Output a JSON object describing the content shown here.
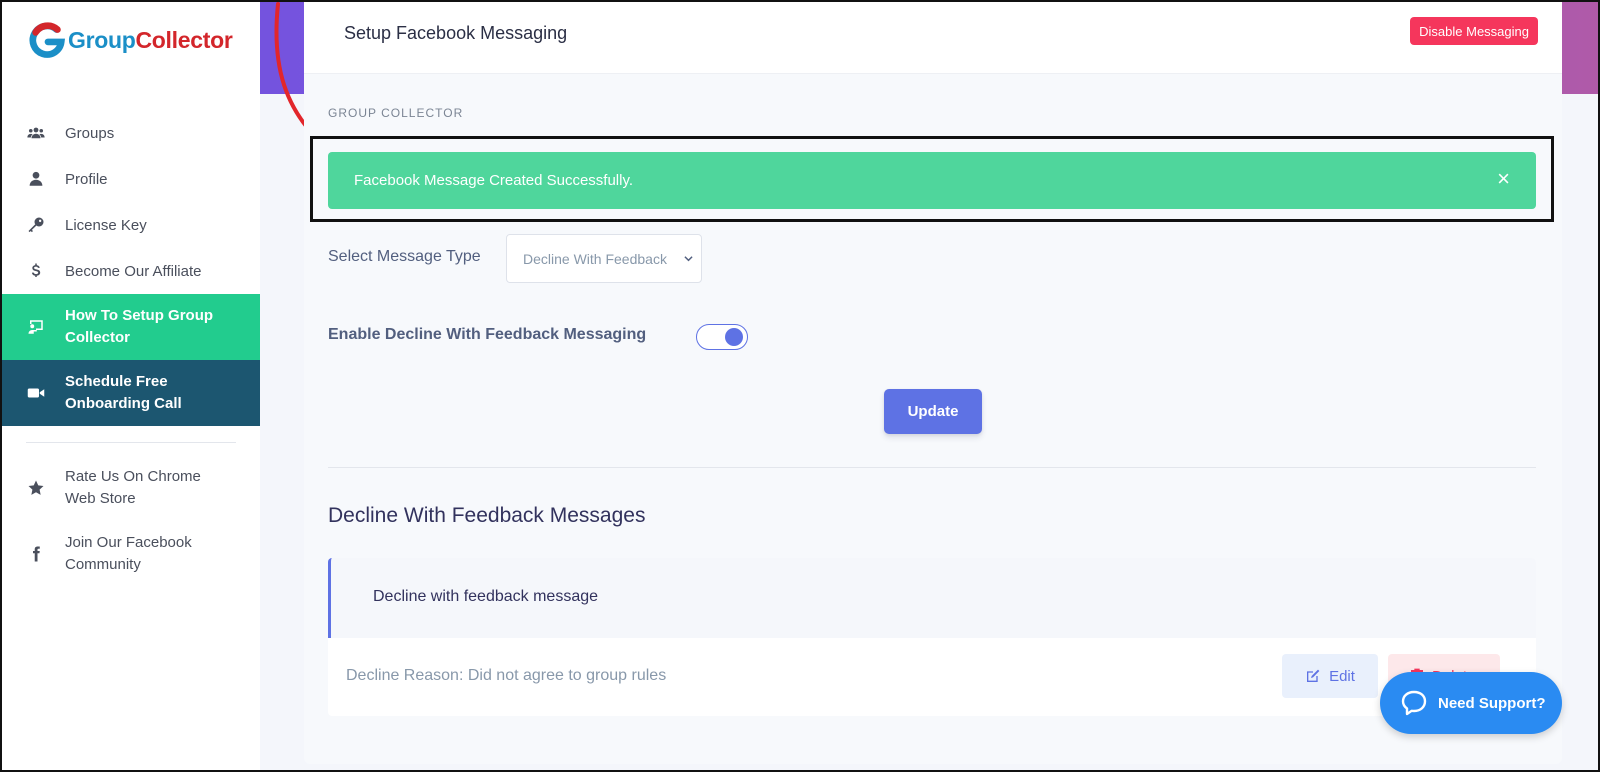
{
  "brand": {
    "name_part1": "Group",
    "name_part2": "Collector"
  },
  "sidebar": {
    "items": [
      {
        "label": "Groups",
        "icon": "users-icon"
      },
      {
        "label": "Profile",
        "icon": "user-icon"
      },
      {
        "label": "License Key",
        "icon": "key-icon"
      },
      {
        "label": "Become Our Affiliate",
        "icon": "dollar-icon"
      },
      {
        "label": "How To Setup Group Collector",
        "icon": "presentation-icon",
        "state": "active"
      },
      {
        "label": "Schedule Free Onboarding Call",
        "icon": "video-icon",
        "state": "highlight"
      },
      {
        "label": "Rate Us On Chrome Web Store",
        "icon": "star-icon"
      },
      {
        "label": "Join Our Facebook Community",
        "icon": "facebook-icon"
      }
    ]
  },
  "header": {
    "title": "Setup Facebook Messaging",
    "disable_button": "Disable Messaging"
  },
  "main": {
    "section_caption": "GROUP COLLECTOR",
    "alert": {
      "message": "Facebook Message Created Successfully.",
      "close": "×"
    },
    "message_type": {
      "label": "Select Message Type",
      "selected": "Decline With Feedback"
    },
    "toggle": {
      "label": "Enable Decline With Feedback Messaging",
      "enabled": true
    },
    "update_button": "Update",
    "messages_heading": "Decline With Feedback Messages",
    "messages": [
      {
        "text": "Decline with feedback message",
        "reason": "Decline Reason: Did not agree to group rules",
        "edit_label": "Edit",
        "delete_label": "Delete"
      }
    ]
  },
  "support_widget": {
    "label": "Need Support?"
  },
  "colors": {
    "accent": "#5e72e4",
    "success": "#4fd69c",
    "danger": "#f5365c",
    "sidebar_active": "#22cc8e",
    "sidebar_highlight": "#1c5670",
    "support": "#2a8bf2"
  }
}
